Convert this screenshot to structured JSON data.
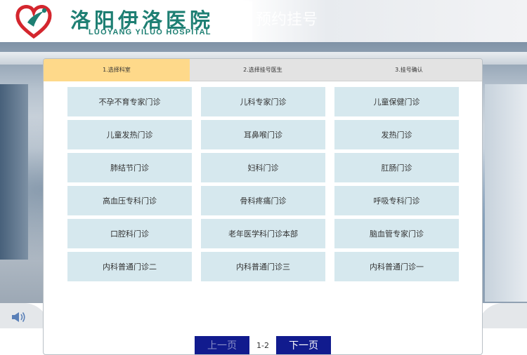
{
  "header": {
    "hospital_name_cn": "洛阳伊洛医院",
    "hospital_name_en": "LUOYANG YILUO HOSPITAL",
    "page_title": "预约挂号",
    "brand_color": "#1e7f73",
    "logo_accent": "#d4262e"
  },
  "steps": [
    {
      "label": "1.选择科室",
      "active": true
    },
    {
      "label": "2.选择挂号医生",
      "active": false
    },
    {
      "label": "3.挂号确认",
      "active": false
    }
  ],
  "departments": [
    "不孕不育专家门诊",
    "儿科专家门诊",
    "儿童保健门诊",
    "儿童发热门诊",
    "耳鼻喉门诊",
    "发热门诊",
    "肺结节门诊",
    "妇科门诊",
    "肛肠门诊",
    "高血压专科门诊",
    "骨科疼痛门诊",
    "呼吸专科门诊",
    "口腔科门诊",
    "老年医学科门诊本部",
    "脑血管专家门诊",
    "内科普通门诊二",
    "内科普通门诊三",
    "内科普通门诊一"
  ],
  "pagination": {
    "prev_label": "上一页",
    "next_label": "下一页",
    "page_info": "1-2",
    "button_color": "#111b8e"
  },
  "icons": {
    "announcement": "speaker-icon"
  },
  "colors": {
    "active_step": "#fed98a",
    "department_tile": "#d6e8ee"
  }
}
